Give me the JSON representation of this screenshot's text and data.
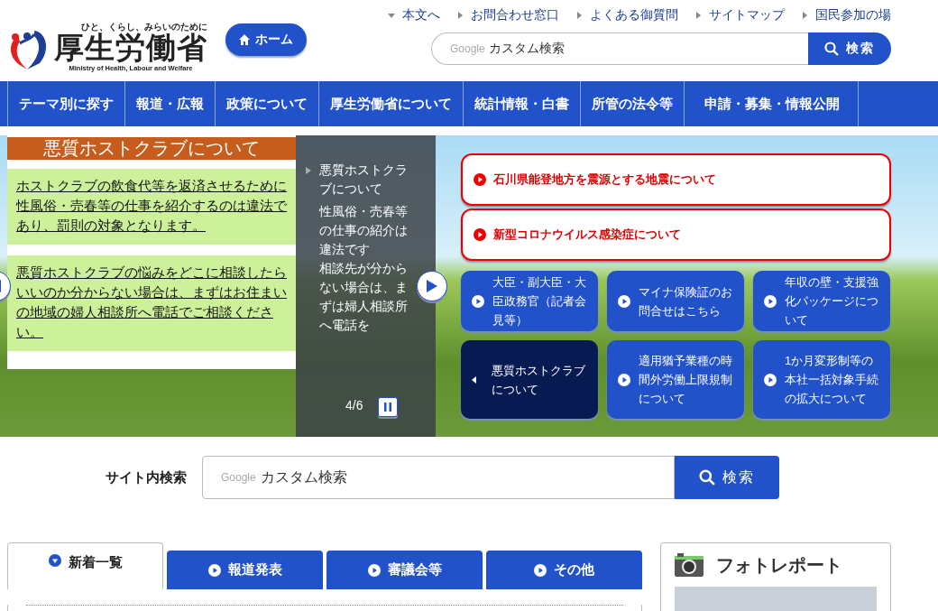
{
  "header": {
    "logo": {
      "tagline": "ひと、くらし、みらいのために",
      "name": "厚生労働省",
      "english": "Ministry of Health, Labour and Welfare"
    },
    "home_button": "ホーム",
    "top_links": [
      {
        "label": "本文へ",
        "kind": "down"
      },
      {
        "label": "お問合わせ窓口",
        "kind": "right"
      },
      {
        "label": "よくある御質問",
        "kind": "right"
      },
      {
        "label": "サイトマップ",
        "kind": "right"
      },
      {
        "label": "国民参加の場",
        "kind": "right"
      }
    ],
    "search": {
      "brand": "Google",
      "placeholder": "カスタム検索",
      "button": "検索"
    }
  },
  "nav": [
    "テーマ別に探す",
    "報道・広報",
    "政策について",
    "厚生労働省について",
    "統計情報・白書",
    "所管の法令等",
    "申請・募集・情報公開"
  ],
  "hero": {
    "slide": {
      "title": "悪質ホストクラブについて",
      "paragraphs": [
        "ホストクラブの飲食代等を返済させるために性風俗・売春等の仕事を紹介するのは違法であり、罰則の対象となります。",
        "悪質ホストクラブの悩みをどこに相談したらいいのか分からない場合は、まずはお住まいの地域の婦人相談所へ電話でご相談ください。"
      ]
    },
    "caption": {
      "title": "悪質ホストクラブについて",
      "lines": [
        "性風俗・売春等の仕事の紹介は違法です",
        "相談先が分からない場合は、まずは婦人相談所へ電話を"
      ]
    },
    "counter": "4/6",
    "alerts": [
      "石川県能登地方を震源とする地震について",
      "新型コロナウイルス感染症について"
    ],
    "items": [
      {
        "label": "大臣・副大臣・大臣政務官（記者会見等）",
        "selected": false
      },
      {
        "label": "マイナ保険証のお問合せはこちら",
        "selected": false
      },
      {
        "label": "年収の壁・支援強化パッケージについて",
        "selected": false
      },
      {
        "label": "悪質ホストクラブについて",
        "selected": true
      },
      {
        "label": "適用猶予業種の時間外労働上限規制について",
        "selected": false
      },
      {
        "label": "1か月変形制等の本社一括対象手続の拡大について",
        "selected": false
      }
    ]
  },
  "site_search": {
    "label": "サイト内検索",
    "brand": "Google",
    "placeholder": "カスタム検索",
    "button": "検索"
  },
  "news_tabs": [
    {
      "label": "新着一覧",
      "selected": true
    },
    {
      "label": "報道発表",
      "selected": false
    },
    {
      "label": "審議会等",
      "selected": false
    },
    {
      "label": "その他",
      "selected": false
    }
  ],
  "photo_report": {
    "title": "フォトレポート"
  }
}
